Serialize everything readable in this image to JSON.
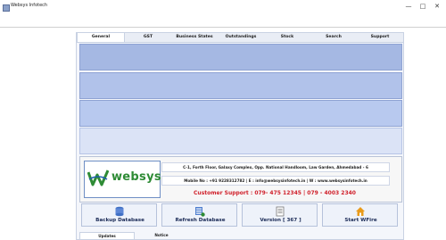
{
  "window": {
    "title": "Websys Infotech",
    "minimize": "—",
    "maximize": "□",
    "close": "✕"
  },
  "tabs": [
    {
      "label": "General",
      "active": true
    },
    {
      "label": "GST"
    },
    {
      "label": "Business States"
    },
    {
      "label": "Outstandings"
    },
    {
      "label": "Stock"
    },
    {
      "label": "Search"
    },
    {
      "label": "Support"
    }
  ],
  "company": {
    "logo_text": "websys",
    "address": "C-1, Forth Floor, Galaxy Complex, Opp. National Handloom, Law Garden,  Ahmedabad - 6",
    "contact": "Mobile  No : +91 9228312782 | E : info@websysinfotech.in | W : www.websysinfotech.in",
    "support": "Customer Support : 079- 475 12345 | 079 - 4003 2340"
  },
  "actions": {
    "backup": "Backup Database",
    "refresh": "Refresh Database",
    "version": "Version [ 367 ]",
    "start": "Start WFire"
  },
  "bottom_tabs": [
    {
      "label": "Updates",
      "active": true
    },
    {
      "label": "Notice"
    }
  ],
  "colors": {
    "brand_green": "#2e8b35",
    "support_red": "#d0202a",
    "band_blue": "#a5b8e3"
  },
  "icons": {
    "backup": "database-backup-icon",
    "refresh": "database-refresh-icon",
    "version": "document-icon",
    "start": "home-icon"
  }
}
